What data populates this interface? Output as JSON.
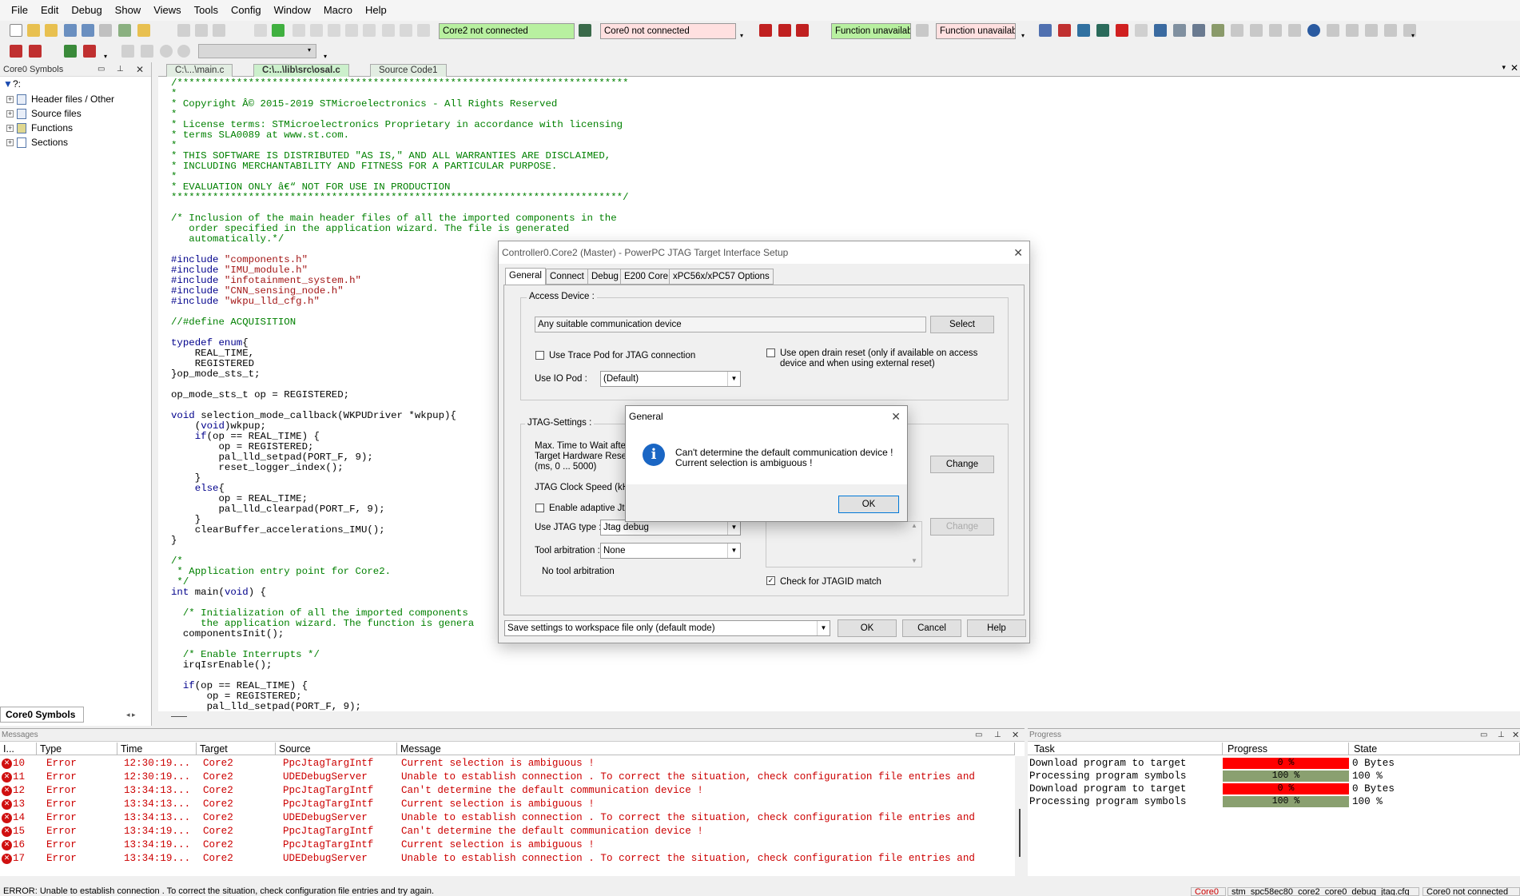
{
  "menu": [
    "File",
    "Edit",
    "Debug",
    "Show",
    "Views",
    "Tools",
    "Config",
    "Window",
    "Macro",
    "Help"
  ],
  "toolbar": {
    "core2_status": "Core2 not connected",
    "core0_status": "Core0 not connected",
    "function_status_1": "Function unavailabl",
    "function_status_2": "Function unavailabl"
  },
  "left_panel": {
    "title": "Core0 Symbols",
    "filter_label": "?:",
    "items": [
      "Header files / Other",
      "Source files",
      "Functions",
      "Sections"
    ],
    "bottom_tab": "Core0 Symbols"
  },
  "editor": {
    "tabs": [
      "C:\\...\\main.c",
      "C:\\...\\lib\\src\\osal.c",
      "Source Code1"
    ],
    "code": [
      [
        [
          "cm",
          "/****************************************************************************"
        ]
      ],
      [
        [
          "cm",
          "*"
        ]
      ],
      [
        [
          "cm",
          "* Copyright Â© 2015-2019 STMicroelectronics - All Rights Reserved"
        ]
      ],
      [
        [
          "cm",
          "*"
        ]
      ],
      [
        [
          "cm",
          "* License terms: STMicroelectronics Proprietary in accordance with licensing"
        ]
      ],
      [
        [
          "cm",
          "* terms SLA0089 at www.st.com."
        ]
      ],
      [
        [
          "cm",
          "*"
        ]
      ],
      [
        [
          "cm",
          "* THIS SOFTWARE IS DISTRIBUTED \"AS IS,\" AND ALL WARRANTIES ARE DISCLAIMED,"
        ]
      ],
      [
        [
          "cm",
          "* INCLUDING MERCHANTABILITY AND FITNESS FOR A PARTICULAR PURPOSE."
        ]
      ],
      [
        [
          "cm",
          "*"
        ]
      ],
      [
        [
          "cm",
          "* EVALUATION ONLY â€“ NOT FOR USE IN PRODUCTION"
        ]
      ],
      [
        [
          "cm",
          "****************************************************************************/"
        ]
      ],
      [],
      [
        [
          "cm",
          "/* Inclusion of the main header files of all the imported components in the"
        ]
      ],
      [
        [
          "cm",
          "   order specified in the application wizard. The file is generated"
        ]
      ],
      [
        [
          "cm",
          "   automatically.*/"
        ]
      ],
      [],
      [
        [
          "kw",
          "#include "
        ],
        [
          "st",
          "\"components.h\""
        ]
      ],
      [
        [
          "kw",
          "#include "
        ],
        [
          "st",
          "\"IMU_module.h\""
        ]
      ],
      [
        [
          "kw",
          "#include "
        ],
        [
          "st",
          "\"infotainment_system.h\""
        ]
      ],
      [
        [
          "kw",
          "#include "
        ],
        [
          "st",
          "\"CNN_sensing_node.h\""
        ]
      ],
      [
        [
          "kw",
          "#include "
        ],
        [
          "st",
          "\"wkpu_lld_cfg.h\""
        ]
      ],
      [],
      [
        [
          "cm",
          "//#define ACQUISITION"
        ]
      ],
      [],
      [
        [
          "kw",
          "typedef enum"
        ],
        [
          "",
          "{"
        ]
      ],
      [
        [
          "",
          "    REAL_TIME,"
        ]
      ],
      [
        [
          "",
          "    REGISTERED"
        ]
      ],
      [
        [
          "",
          "}op_mode_sts_t;"
        ]
      ],
      [],
      [
        [
          "",
          "op_mode_sts_t op = REGISTERED;"
        ]
      ],
      [],
      [
        [
          "kw",
          "void "
        ],
        [
          "",
          "selection_mode_callback(WKPUDriver *wkpup){"
        ]
      ],
      [
        [
          "",
          "    ("
        ],
        [
          "kw",
          "void"
        ],
        [
          "",
          ")wkpup;"
        ]
      ],
      [
        [
          "kw",
          "    if"
        ],
        [
          "",
          "(op == REAL_TIME) {"
        ]
      ],
      [
        [
          "",
          "        op = REGISTERED;"
        ]
      ],
      [
        [
          "",
          "        pal_lld_setpad(PORT_F, 9);"
        ]
      ],
      [
        [
          "",
          "        reset_logger_index();"
        ]
      ],
      [
        [
          "",
          "    }"
        ]
      ],
      [
        [
          "kw",
          "    else"
        ],
        [
          "",
          "{"
        ]
      ],
      [
        [
          "",
          "        op = REAL_TIME;"
        ]
      ],
      [
        [
          "",
          "        pal_lld_clearpad(PORT_F, 9);"
        ]
      ],
      [
        [
          "",
          "    }"
        ]
      ],
      [
        [
          "",
          "    clearBuffer_accelerations_IMU();"
        ]
      ],
      [
        [
          "",
          "}"
        ]
      ],
      [],
      [
        [
          "cm",
          "/*"
        ]
      ],
      [
        [
          "cm",
          " * Application entry point for Core2."
        ]
      ],
      [
        [
          "cm",
          " */"
        ]
      ],
      [
        [
          "kw",
          "int "
        ],
        [
          "",
          "main("
        ],
        [
          "kw",
          "void"
        ],
        [
          "",
          ") {"
        ]
      ],
      [],
      [
        [
          "cm",
          "  /* Initialization of all the imported components"
        ]
      ],
      [
        [
          "cm",
          "     the application wizard. The function is genera"
        ]
      ],
      [
        [
          "",
          "  componentsInit();"
        ]
      ],
      [],
      [
        [
          "cm",
          "  /* Enable Interrupts */"
        ]
      ],
      [
        [
          "",
          "  irqIsrEnable();"
        ]
      ],
      [],
      [
        [
          "kw",
          "  if"
        ],
        [
          "",
          "(op == REAL_TIME) {"
        ]
      ],
      [
        [
          "",
          "      op = REGISTERED;"
        ]
      ],
      [
        [
          "",
          "      pal_lld_setpad(PORT_F, 9);"
        ]
      ]
    ]
  },
  "jtag_dialog": {
    "title": "Controller0.Core2 (Master) - PowerPC JTAG Target Interface Setup",
    "tabs": [
      "General",
      "Connect",
      "Debug",
      "E200 Core",
      "xPC56x/xPC57 Options"
    ],
    "access_device_label": "Access Device :",
    "access_device_value": "Any suitable communication device",
    "select_button": "Select",
    "use_trace_pod": "Use Trace Pod for JTAG connection",
    "open_drain_reset": "Use open drain reset (only if available on access device and when using external reset)",
    "use_io_pod_label": "Use IO Pod :",
    "use_io_pod_value": "(Default)",
    "jtag_settings_label": "JTAG-Settings :",
    "max_time_label_1": "Max. Time to Wait after",
    "max_time_label_2": "Target Hardware Reset",
    "max_time_label_3": "(ms, 0 ... 5000)",
    "change_button": "Change",
    "clock_speed_label": "JTAG Clock Speed (kH",
    "adaptive_label": "Enable adaptive Jta",
    "jtag_type_label": "Use JTAG type :",
    "jtag_type_value": "Jtag debug",
    "change_button_2": "Change",
    "tool_arbitration_label": "Tool arbitration :",
    "tool_arbitration_value": "None",
    "no_tool_arbitration": "No tool arbitration",
    "check_jtagid": "Check for JTAGID match",
    "save_settings_value": "Save settings to workspace file only (default mode)",
    "ok": "OK",
    "cancel": "Cancel",
    "help": "Help"
  },
  "message_box": {
    "title": "General",
    "line1": "Can't determine the default communication device !",
    "line2": "Current selection is ambiguous !",
    "ok": "OK"
  },
  "messages_panel": {
    "title": "Messages",
    "columns": [
      "I...",
      "Type",
      "Time",
      "Target",
      "Source",
      "Message"
    ],
    "rows": [
      {
        "id": "10",
        "type": "Error",
        "time": "12:30:19...",
        "target": "Core2",
        "source": "PpcJtagTargIntf",
        "message": "Current selection is ambiguous !"
      },
      {
        "id": "11",
        "type": "Error",
        "time": "12:30:19...",
        "target": "Core2",
        "source": "UDEDebugServer",
        "message": "Unable to establish connection . To correct the situation, check configuration file entries and"
      },
      {
        "id": "12",
        "type": "Error",
        "time": "13:34:13...",
        "target": "Core2",
        "source": "PpcJtagTargIntf",
        "message": "Can't determine the default communication device !"
      },
      {
        "id": "13",
        "type": "Error",
        "time": "13:34:13...",
        "target": "Core2",
        "source": "PpcJtagTargIntf",
        "message": "Current selection is ambiguous !"
      },
      {
        "id": "14",
        "type": "Error",
        "time": "13:34:13...",
        "target": "Core2",
        "source": "UDEDebugServer",
        "message": "Unable to establish connection . To correct the situation, check configuration file entries and"
      },
      {
        "id": "15",
        "type": "Error",
        "time": "13:34:19...",
        "target": "Core2",
        "source": "PpcJtagTargIntf",
        "message": "Can't determine the default communication device !"
      },
      {
        "id": "16",
        "type": "Error",
        "time": "13:34:19...",
        "target": "Core2",
        "source": "PpcJtagTargIntf",
        "message": "Current selection is ambiguous !"
      },
      {
        "id": "17",
        "type": "Error",
        "time": "13:34:19...",
        "target": "Core2",
        "source": "UDEDebugServer",
        "message": "Unable to establish connection . To correct the situation, check configuration file entries and"
      }
    ]
  },
  "progress_panel": {
    "title": "Progress",
    "columns": [
      "Task",
      "Progress",
      "State"
    ],
    "rows": [
      {
        "task": "Download program to target",
        "progress_text": "0 %",
        "progress": 0,
        "state": "0 Bytes"
      },
      {
        "task": "Processing program symbols",
        "progress_text": "100 %",
        "progress": 100,
        "state": "100 %"
      },
      {
        "task": "Download program to target",
        "progress_text": "0 %",
        "progress": 0,
        "state": "0 Bytes"
      },
      {
        "task": "Processing program symbols",
        "progress_text": "100 %",
        "progress": 100,
        "state": "100 %"
      }
    ]
  },
  "status_bar": {
    "message": "ERROR: Unable to establish connection . To correct the situation, check configuration file entries and try again.",
    "core": "Core0",
    "config_file": "stm_spc58ec80_core2_core0_debug_jtag.cfg",
    "core0_status": "Core0 not connected"
  },
  "colors": {
    "code_comment": "#008000",
    "code_keyword": "#00008b",
    "code_string": "#a31515",
    "error_text": "#cc0000",
    "status_connected_bg": "#b8f0a0",
    "status_disconnected_bg": "#ffe0e0",
    "progress_zero": "#ff0000",
    "progress_full": "#8aa070"
  }
}
